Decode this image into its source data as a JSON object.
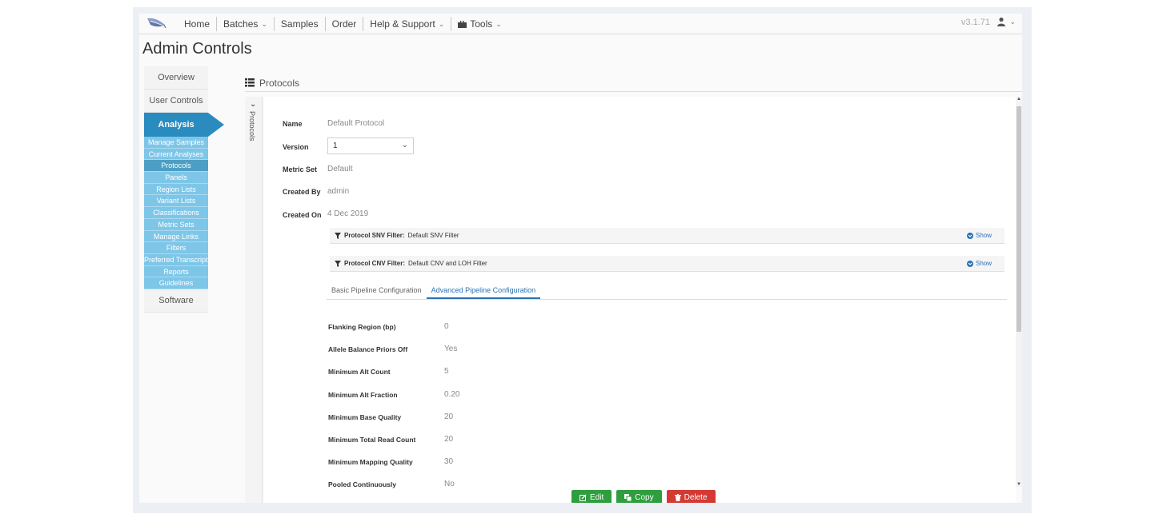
{
  "nav": {
    "items": [
      {
        "label": "Home",
        "caret": false,
        "name": "nav-home"
      },
      {
        "label": "Batches",
        "caret": true,
        "name": "nav-batches"
      },
      {
        "label": "Samples",
        "caret": false,
        "name": "nav-samples"
      },
      {
        "label": "Order",
        "caret": false,
        "name": "nav-order"
      },
      {
        "label": "Help & Support",
        "caret": true,
        "name": "nav-help-support"
      },
      {
        "label": "Tools",
        "caret": true,
        "name": "nav-tools"
      }
    ],
    "version": "v3.1.71"
  },
  "page_title": "Admin Controls",
  "sidebar": {
    "overview": "Overview",
    "user_controls": "User Controls",
    "analysis": "Analysis",
    "sub_items": [
      "Manage Samples",
      "Current Analyses",
      "Protocols",
      "Panels",
      "Region Lists",
      "Variant Lists",
      "Classifications",
      "Metric Sets",
      "Manage Links",
      "Filters",
      "Preferred Transcripts",
      "Reports",
      "Guidelines"
    ],
    "active_sub": "Protocols",
    "software": "Software"
  },
  "protocols": {
    "header": "Protocols",
    "side_tab": "Protocols",
    "labels": {
      "name": "Name",
      "version": "Version",
      "metric_set": "Metric Set",
      "created_by": "Created By",
      "created_on": "Created On"
    },
    "values": {
      "name": "Default Protocol",
      "version": "1",
      "metric_set": "Default",
      "created_by": "admin",
      "created_on": "4 Dec 2019"
    },
    "snv_filter": {
      "label": "Protocol SNV Filter:",
      "value": "Default SNV Filter",
      "show": "Show"
    },
    "cnv_filter": {
      "label": "Protocol CNV Filter:",
      "value": "Default CNV and LOH Filter",
      "show": "Show"
    },
    "tabs": [
      "Basic Pipeline Configuration",
      "Advanced Pipeline Configuration"
    ],
    "active_tab": "Advanced Pipeline Configuration",
    "config": [
      {
        "label": "Flanking Region (bp)",
        "value": "0"
      },
      {
        "label": "Allele Balance Priors Off",
        "value": "Yes"
      },
      {
        "label": "Minimum Alt Count",
        "value": "5"
      },
      {
        "label": "Minimum Alt Fraction",
        "value": "0.20"
      },
      {
        "label": "Minimum Base Quality",
        "value": "20"
      },
      {
        "label": "Minimum Total Read Count",
        "value": "20"
      },
      {
        "label": "Minimum Mapping Quality",
        "value": "30"
      },
      {
        "label": "Pooled Continuously",
        "value": "No"
      }
    ]
  },
  "buttons": {
    "edit": "Edit",
    "copy": "Copy",
    "delete": "Delete"
  },
  "colors": {
    "accent": "#2a8bbf",
    "subnav": "#7ec6e8",
    "link": "#2a72b3",
    "success": "#2e9e3e",
    "danger": "#d43a33"
  }
}
